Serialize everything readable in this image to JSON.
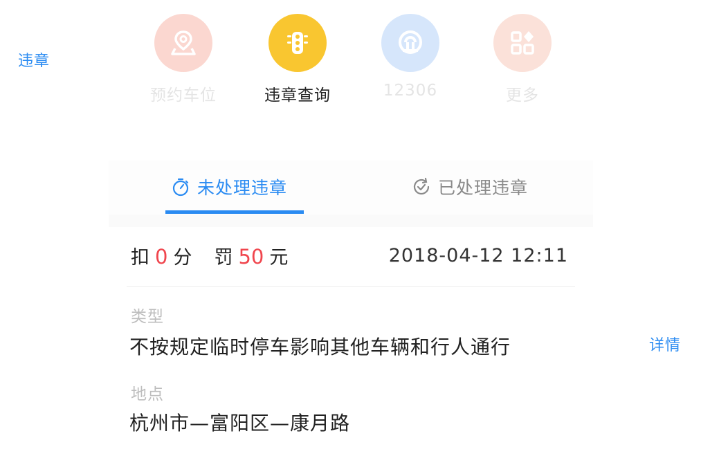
{
  "annotations": {
    "left_label": "违章",
    "right_label": "详情"
  },
  "nav": {
    "items": [
      {
        "label": "预约车位",
        "icon": "parking-location-icon",
        "color": "#fbd7d0",
        "state": "faded"
      },
      {
        "label": "违章查询",
        "icon": "traffic-light-icon",
        "color": "#f9c630",
        "state": "active"
      },
      {
        "label": "12306",
        "icon": "railway-icon",
        "color": "#d6e6fb",
        "state": "faded"
      },
      {
        "label": "更多",
        "icon": "apps-grid-icon",
        "color": "#fbe1d9",
        "state": "faded"
      }
    ]
  },
  "tabs": {
    "unprocessed": "未处理违章",
    "processed": "已处理违章",
    "active": "unprocessed",
    "accent_color": "#2a8bf2"
  },
  "record": {
    "deduct_prefix": "扣",
    "deduct_points": "0",
    "deduct_unit": "分",
    "fine_prefix": "罚",
    "fine_amount": "50",
    "fine_unit": "元",
    "datetime": "2018-04-12 12:11",
    "type_label": "类型",
    "type_value": "不按规定临时停车影响其他车辆和行人通行",
    "location_label": "地点",
    "location_value": "杭州市—富阳区—康月路",
    "highlight_color": "#f0454d"
  }
}
